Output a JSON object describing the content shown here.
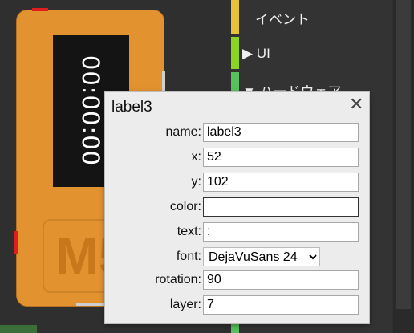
{
  "popup": {
    "title": "label3",
    "close_glyph": "✕",
    "fields": {
      "name_label": "name:",
      "name_value": "label3",
      "x_label": "x:",
      "x_value": "52",
      "y_label": "y:",
      "y_value": "102",
      "color_label": "color:",
      "color_value": "",
      "text_label": "text:",
      "text_value": ":",
      "font_label": "font:",
      "font_value": "DejaVuSans 24",
      "rotation_label": "rotation:",
      "rotation_value": "90",
      "layer_label": "layer:",
      "layer_value": "7"
    }
  },
  "device": {
    "display_time": "00:00:00",
    "logo_text": "M5"
  },
  "toolbox": {
    "items": [
      {
        "label": "イベント",
        "color": "#e6c23a"
      },
      {
        "label": "▶ UI",
        "color": "#8bd420"
      },
      {
        "label": "▼ ハードウェア",
        "color": "#58c05d"
      }
    ]
  }
}
